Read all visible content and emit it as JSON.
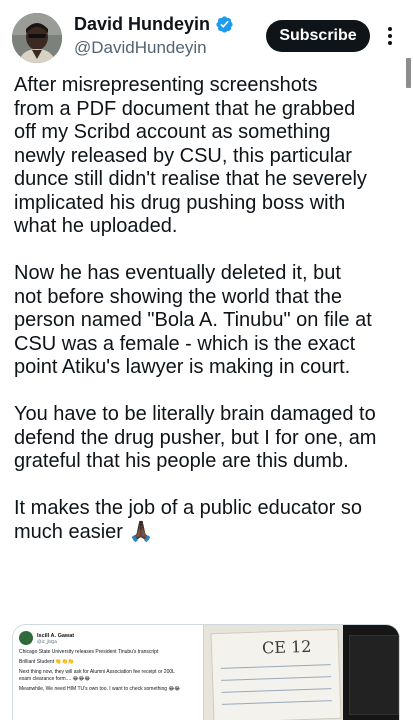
{
  "author": {
    "display_name": "David Hundeyin",
    "handle": "@DavidHundeyin",
    "verified_icon": "verified-badge-icon",
    "verified_color": "#1d9bf0"
  },
  "actions": {
    "subscribe_label": "Subscribe",
    "more_icon": "more-vertical-icon"
  },
  "tweet": {
    "paragraphs": [
      "After misrepresenting screenshots\nfrom a PDF document that he grabbed\noff my Scribd account as something\nnewly released by CSU, this particular\ndunce still didn't realise that he severely\nimplicated his drug pushing boss with\nwhat he uploaded.",
      "Now he has eventually deleted it, but\nnot before showing the world that the\nperson named \"Bola A. Tinubu\" on file at\nCSU was a female - which is the exact\npoint Atiku's lawyer is making in court.",
      "You have to be literally brain damaged to\ndefend the drug pusher, but I for one, am\ngrateful that his people are this dumb.",
      "It makes the job of a public educator so\nmuch easier 🙏🏿"
    ]
  },
  "media": {
    "quoted_post": {
      "name": "Iscill A. Gawat",
      "handle": "@iz_jbQa",
      "lines": [
        "Chicago State University releases President Tinubu's transcript",
        "Brilliant Student 👏👏👏",
        "Next thing now, they will ask for Alumni Association fee receipt or 200L",
        "exam clearance form.... 😂😂😂",
        "Meanwhile, We need HIM TU's own too. I want to check something 😂😂"
      ]
    },
    "document_scribble": "CE 12"
  },
  "colors": {
    "text_primary": "#0f1419",
    "text_secondary": "#536471",
    "button_bg": "#0f1419"
  }
}
